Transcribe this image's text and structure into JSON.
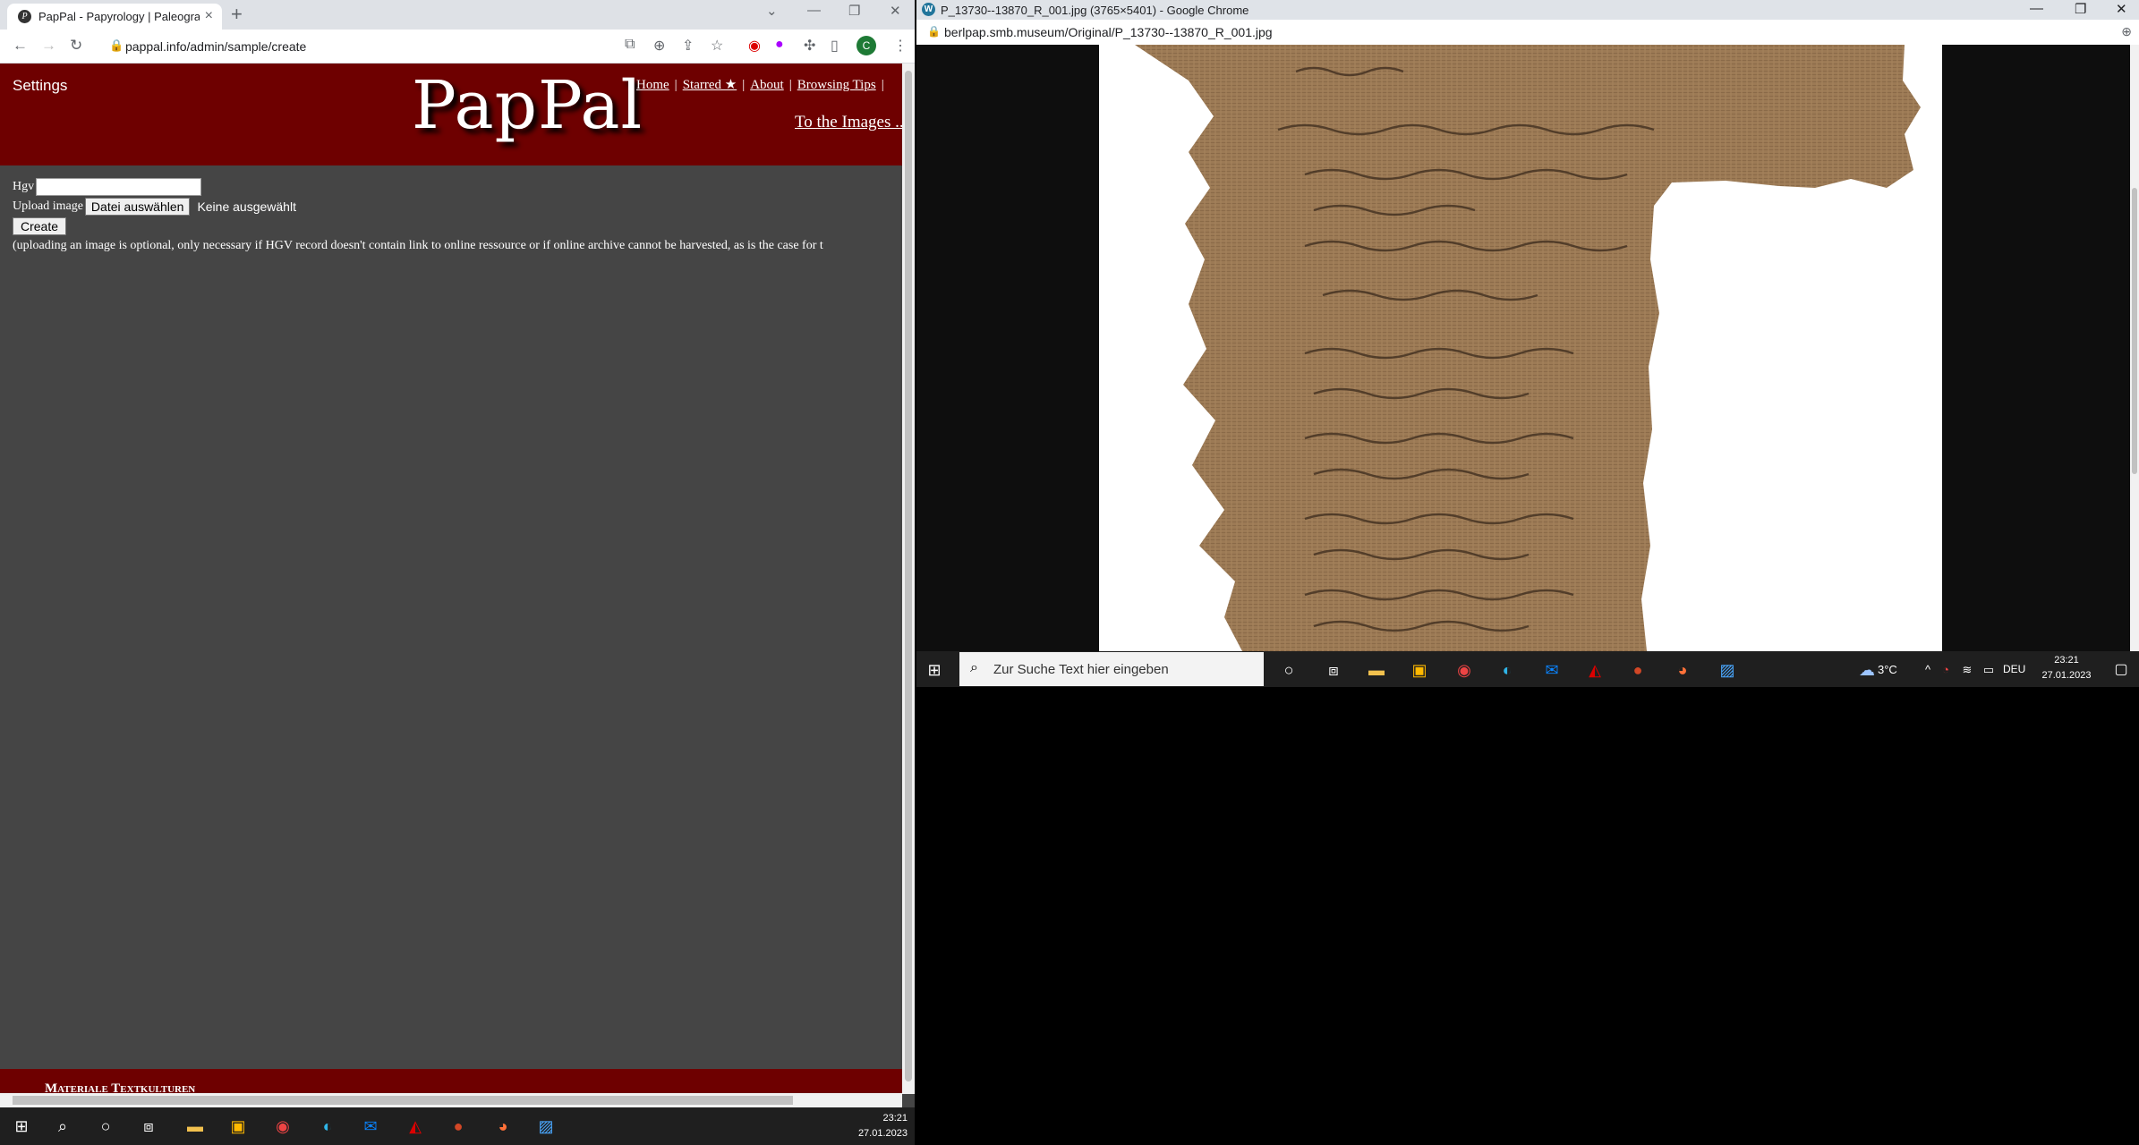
{
  "left_window": {
    "tab_title": "PapPal - Papyrology | Paleograph",
    "url": "pappal.info/admin/sample/create",
    "profile_initial": "C",
    "page": {
      "settings": "Settings",
      "logo": "PapPal",
      "nav": [
        "Home",
        "Starred ★",
        "About",
        "Browsing Tips"
      ],
      "to_images": "To the Images ..",
      "form": {
        "hgv_label": "Hgv",
        "upload_label": "Upload image",
        "file_button": "Datei auswählen",
        "file_status": "Keine ausgewählt",
        "create_button": "Create",
        "note": "(uploading an image is optional, only necessary if HGV record doesn't contain link to online ressource or if online archive cannot be harvested, as is the case for t"
      },
      "footer": "Materiale Textkulturen"
    },
    "taskbar": {
      "time": "23:21",
      "date": "27.01.2023"
    }
  },
  "right_window": {
    "title": "P_13730--13870_R_001.jpg (3765×5401) - Google Chrome",
    "url": "berlpap.smb.museum/Original/P_13730--13870_R_001.jpg",
    "taskbar": {
      "search_placeholder": "Zur Suche Text hier eingeben",
      "weather": "3°C",
      "lang": "DEU",
      "time": "23:21",
      "date": "27.01.2023"
    }
  },
  "colors": {
    "header_red": "#6e0000",
    "page_gray": "#454545"
  }
}
